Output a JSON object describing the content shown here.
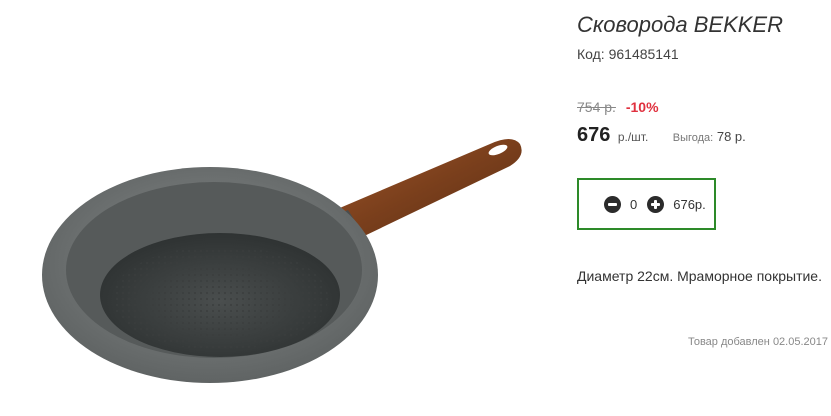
{
  "product": {
    "title": "Сковорода BEKKER",
    "code_label": "Код:",
    "code": "961485141",
    "old_price": "754 р.",
    "discount": "-10%",
    "price": "676",
    "unit": "р./шт.",
    "savings_label": "Выгода:",
    "savings": "78 р.",
    "description": "Диаметр 22см. Мраморное покрытие.",
    "added_label": "Товар добавлен",
    "added_date": "02.05.2017"
  },
  "cart": {
    "quantity": "0",
    "total": "676р.",
    "accent_color": "#2d8a29"
  },
  "icons": {
    "decrease": "minus-circle-icon",
    "increase": "plus-circle-icon"
  },
  "colors": {
    "discount": "#e0313f",
    "pan_body": "#6f7373",
    "handle": "#8a4a22"
  }
}
